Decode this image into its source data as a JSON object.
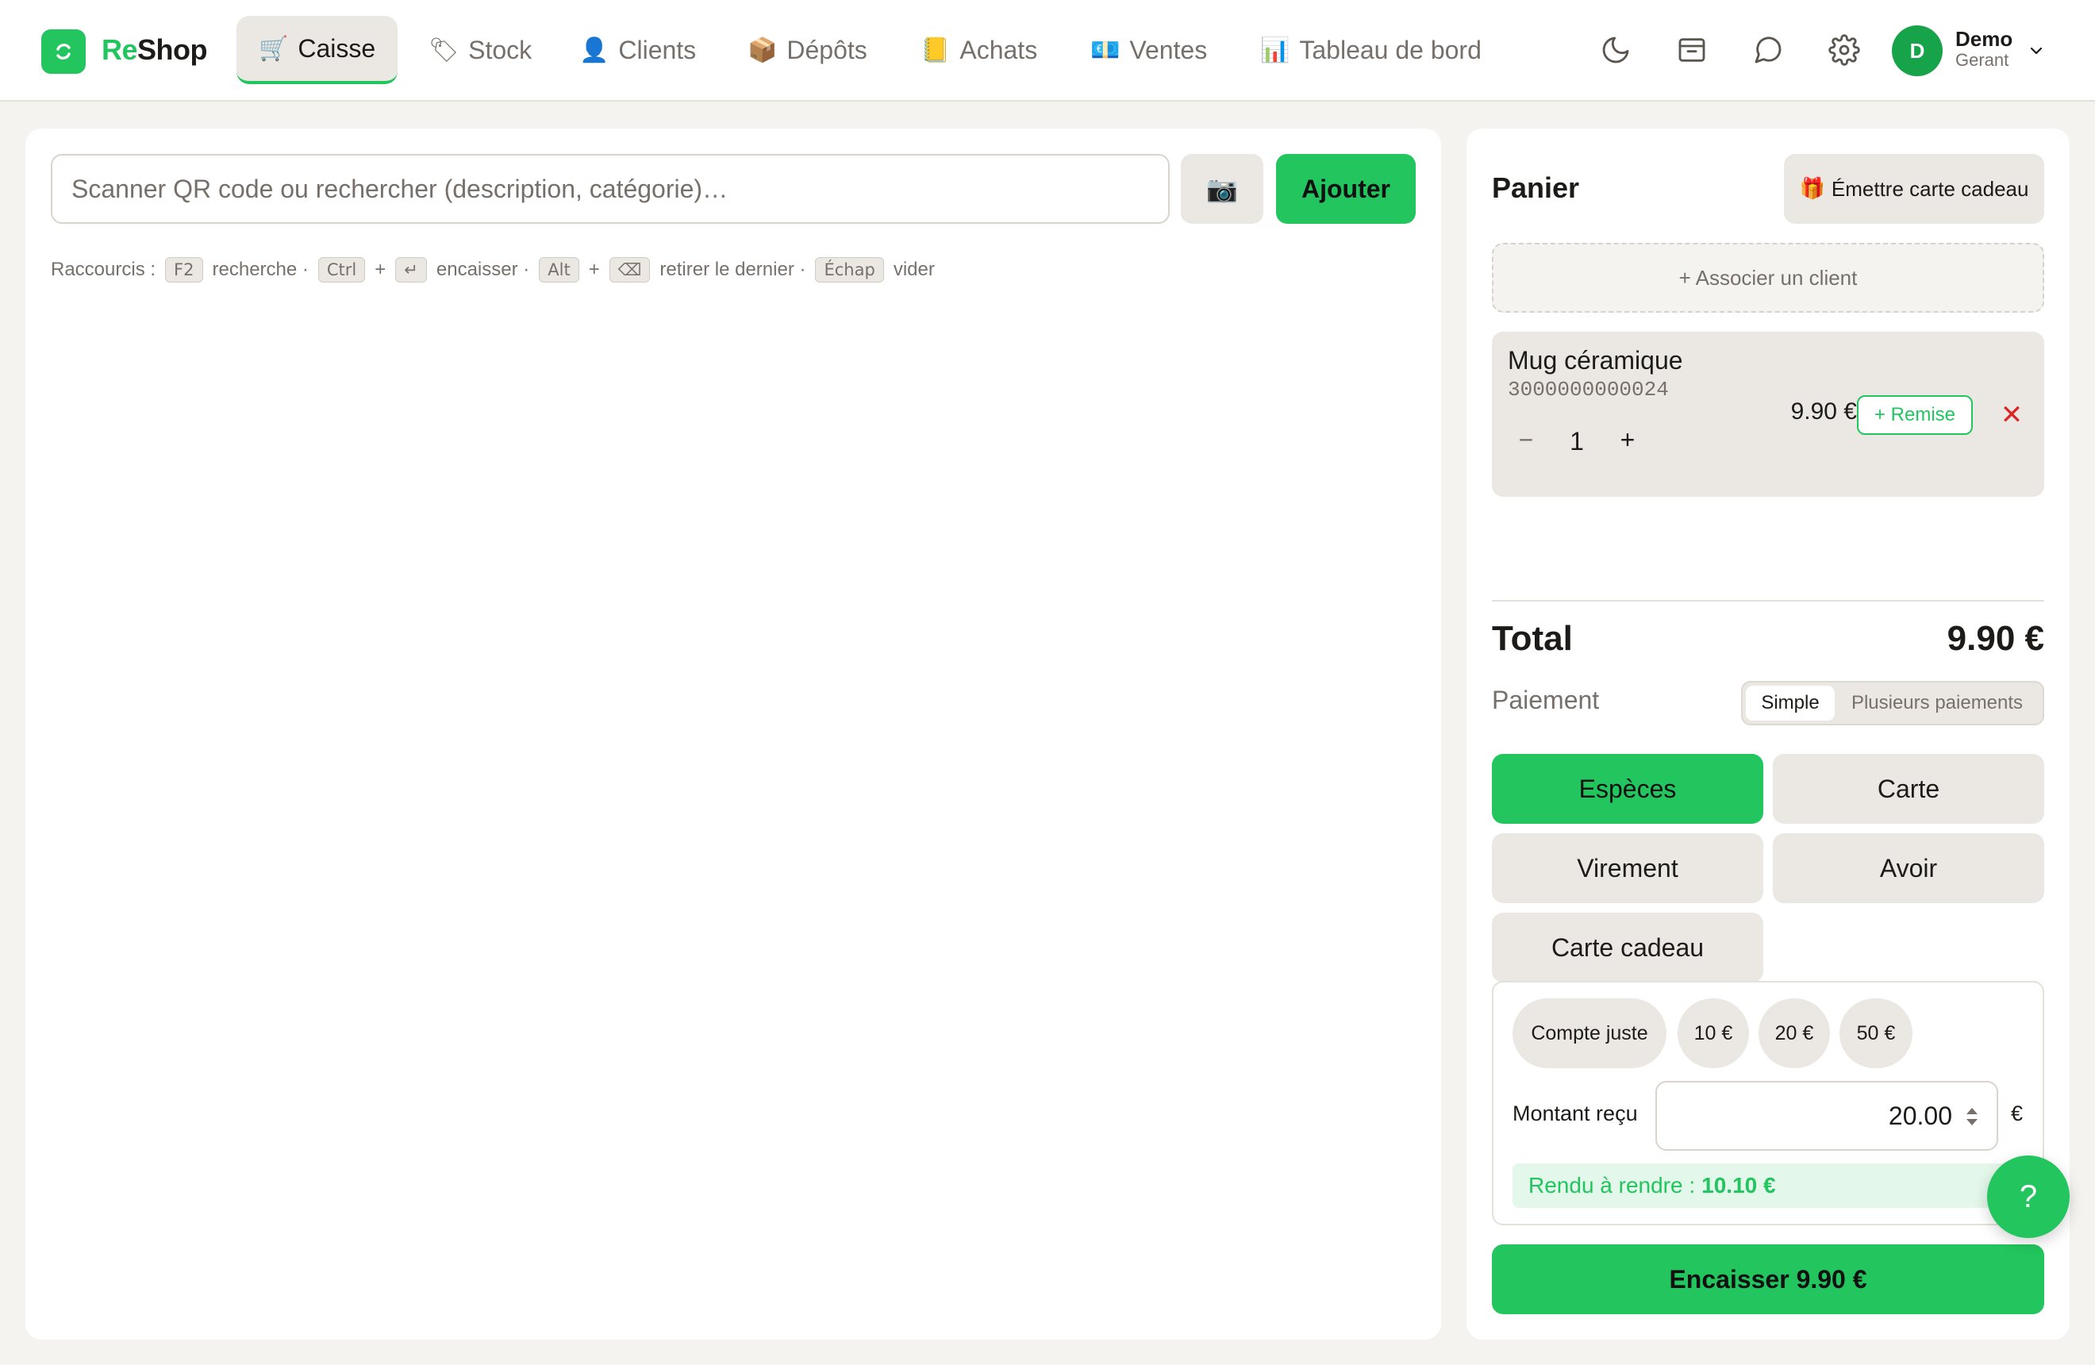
{
  "app": {
    "logo_prefix": "Re",
    "logo_suffix": "Shop",
    "logo_icon": "reshop-logo-icon"
  },
  "nav": {
    "tabs": [
      {
        "emoji": "🛒",
        "label": "Caisse",
        "active": true
      },
      {
        "emoji": "🏷",
        "label": "Stock"
      },
      {
        "emoji": "👤",
        "label": "Clients"
      },
      {
        "emoji": "📦",
        "label": "Dépôts"
      },
      {
        "emoji": "📒",
        "label": "Achats"
      },
      {
        "emoji": "💶",
        "label": "Ventes"
      },
      {
        "emoji": "📊",
        "label": "Tableau de bord"
      }
    ],
    "icons": [
      "moon-icon",
      "archive-icon",
      "chat-icon",
      "gear-icon"
    ],
    "user": {
      "initial": "D",
      "name": "Demo",
      "role": "Gerant"
    }
  },
  "search": {
    "placeholder": "Scanner QR code ou rechercher (description, catégorie)…",
    "camera": "📷",
    "add_label": "Ajouter"
  },
  "shortcuts": {
    "intro": "Raccourcis :",
    "k1": "F2",
    "t1": "recherche ·",
    "k2a": "Ctrl",
    "plus": "+",
    "k2b": "↵",
    "t2": "encaisser ·",
    "k3a": "Alt",
    "k3b": "⌫",
    "t3": "retirer le dernier ·",
    "k4": "Échap",
    "t4": "vider"
  },
  "cart": {
    "title": "Panier",
    "gift_emoji": "🎁",
    "gift_label": "Émettre carte cadeau",
    "assoc_label": "+ Associer un client",
    "items": [
      {
        "name": "Mug céramique",
        "code": "3000000000024",
        "minus": "−",
        "qty": "1",
        "plus": "+",
        "price": "9.90 €",
        "remise": "+ Remise",
        "remove": "✕"
      }
    ],
    "total_label": "Total",
    "total_value": "9.90 €"
  },
  "payment": {
    "label": "Paiement",
    "mode_simple": "Simple",
    "mode_multi": "Plusieurs paiements",
    "methods": [
      "Espèces",
      "Carte",
      "Virement",
      "Avoir",
      "Carte cadeau"
    ],
    "selected_method": "Espèces",
    "quick": [
      "Compte juste",
      "10 €",
      "20 €",
      "50 €"
    ],
    "received_label": "Montant reçu",
    "received_value": "20.00",
    "currency": "€",
    "change_label": "Rendu à rendre :",
    "change_value": "10.10 €",
    "checkout_label": "Encaisser 9.90 €"
  },
  "help": {
    "label": "?"
  },
  "colors": {
    "accent": "#22c55e",
    "danger": "#dc2626",
    "muted": "#77706a",
    "surface": "#ebe8e3"
  }
}
